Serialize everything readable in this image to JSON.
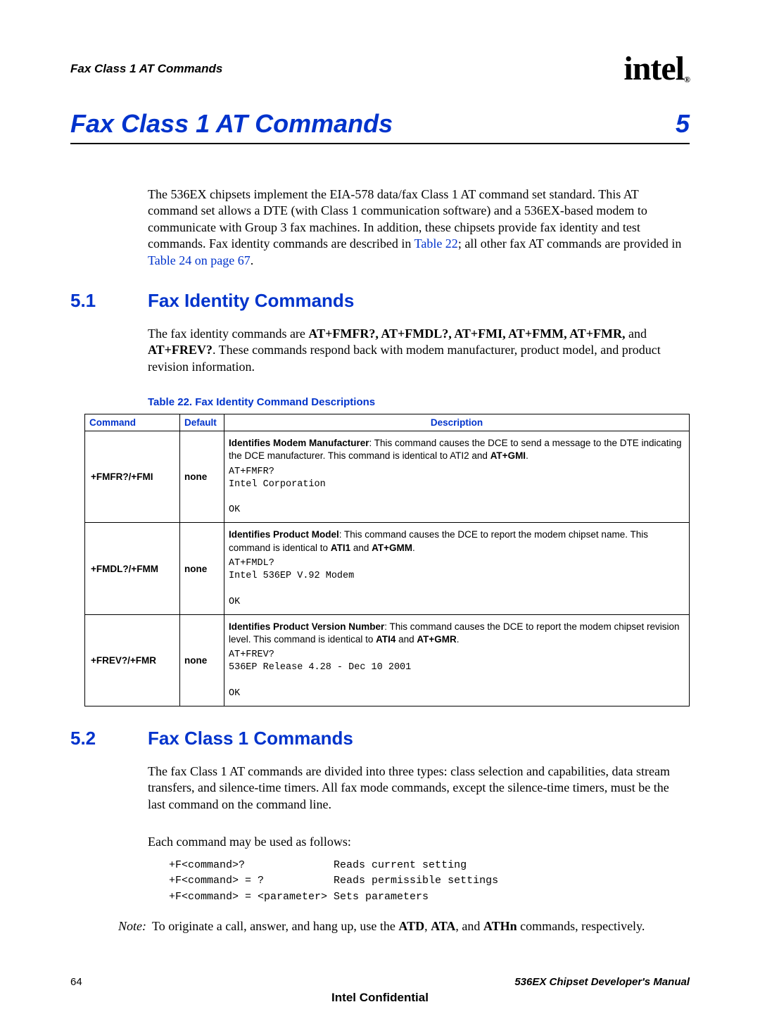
{
  "header": {
    "left": "Fax Class 1 AT Commands",
    "logo_text": "intel",
    "reg": "®"
  },
  "chapter": {
    "title": "Fax Class 1 AT Commands",
    "number": "5"
  },
  "intro": {
    "p1_a": "The 536EX chipsets implement the EIA-578 data/fax Class 1 AT command set standard. This AT command set allows a DTE (with Class 1 communication software) and a 536EX-based modem to communicate with Group 3 fax machines. In addition, these chipsets provide fax identity and test commands. Fax identity commands are described in ",
    "ref1": "Table 22",
    "p1_b": "; all other fax AT commands are provided in ",
    "ref2": "Table 24 on page 67",
    "p1_c": "."
  },
  "section51": {
    "num": "5.1",
    "title": "Fax Identity Commands",
    "p_a": "The fax identity commands are ",
    "cmds": "AT+FMFR?, AT+FMDL?, AT+FMI, AT+FMM, AT+FMR,",
    "p_b": " and ",
    "cmd2": "AT+FREV?",
    "p_c": ". These commands respond back with modem manufacturer, product model, and product revision information."
  },
  "table22": {
    "caption": "Table 22. Fax Identity Command Descriptions",
    "headers": {
      "c1": "Command",
      "c2": "Default",
      "c3": "Description"
    },
    "rows": [
      {
        "command": "+FMFR?/+FMI",
        "default": "none",
        "desc_bold": "Identifies Modem Manufacturer",
        "desc_text": ": This command causes the DCE to send a message to the DTE indicating the DCE manufacturer. This command is identical to ATI2 and ",
        "desc_bold2": "AT+GMI",
        "desc_tail": ".",
        "example": "AT+FMFR?\nIntel Corporation\n\nOK"
      },
      {
        "command": "+FMDL?/+FMM",
        "default": "none",
        "desc_bold": "Identifies Product Model",
        "desc_text": ": This command causes the DCE to report the modem chipset name. This command is identical to ",
        "desc_bold2": "ATI1",
        "desc_mid": " and ",
        "desc_bold3": "AT+GMM",
        "desc_tail": ".",
        "example": "AT+FMDL?\nIntel 536EP V.92 Modem\n\nOK"
      },
      {
        "command": "+FREV?/+FMR",
        "default": "none",
        "desc_bold": "Identifies Product Version Number",
        "desc_text": ": This command causes the DCE to report the modem chipset revision level. This command is identical to ",
        "desc_bold2": "ATI4",
        "desc_mid": " and ",
        "desc_bold3": "AT+GMR",
        "desc_tail": ".",
        "example": "AT+FREV?\n536EP Release 4.28 - Dec 10 2001\n\nOK"
      }
    ]
  },
  "section52": {
    "num": "5.2",
    "title": "Fax Class 1 Commands",
    "p1": "The fax Class 1 AT commands are divided into three types: class selection and capabilities, data stream transfers, and silence-time timers. All fax mode commands, except the silence-time timers, must be the last command on the command line.",
    "p2": "Each command may be used as follows:",
    "usage": "+F<command>?              Reads current setting\n+F<command> = ?           Reads permissible settings\n+F<command> = <parameter> Sets parameters"
  },
  "note": {
    "label": "Note:",
    "text_a": "To originate a call, answer, and hang up, use the ",
    "b1": "ATD",
    "c1": ", ",
    "b2": "ATA",
    "c2": ", and ",
    "b3": "ATHn",
    "text_b": " commands, respectively."
  },
  "footer": {
    "page": "64",
    "right": "536EX Chipset Developer's Manual",
    "center": "Intel Confidential"
  }
}
